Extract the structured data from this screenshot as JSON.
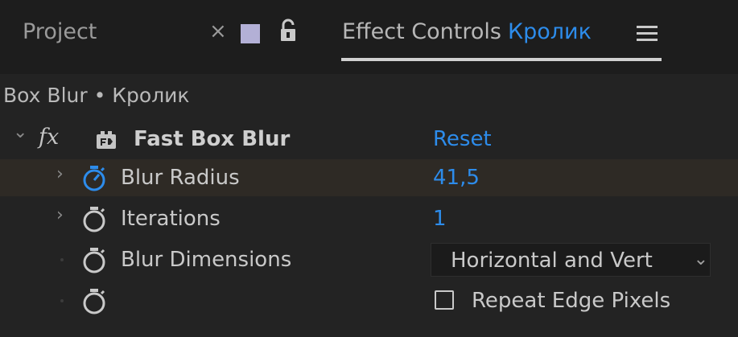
{
  "tabs": {
    "project_label": "Project",
    "close_glyph": "×",
    "swatch_color": "#b3b0d6",
    "effect_controls_label": "Effect Controls",
    "layer_name": "Кролик",
    "accent_color": "#2d8ceb"
  },
  "breadcrumb": "Box Blur • Кролик",
  "effect": {
    "fx_label": "fx",
    "name": "Fast Box Blur",
    "reset_label": "Reset"
  },
  "properties": {
    "blur_radius": {
      "label": "Blur Radius",
      "value": "41,5"
    },
    "iterations": {
      "label": "Iterations",
      "value": "1"
    },
    "blur_dimensions": {
      "label": "Blur Dimensions",
      "value": "Horizontal and Vert"
    },
    "repeat_edge": {
      "label": "Repeat Edge Pixels",
      "checked": false
    }
  },
  "icons": {
    "expanded_chevron": "⌄",
    "collapsed_chevron": "›",
    "dropdown_chevron": "⌄",
    "stopwatch": "stopwatch-icon",
    "lock": "lock-icon",
    "menu": "hamburger-menu-icon"
  }
}
